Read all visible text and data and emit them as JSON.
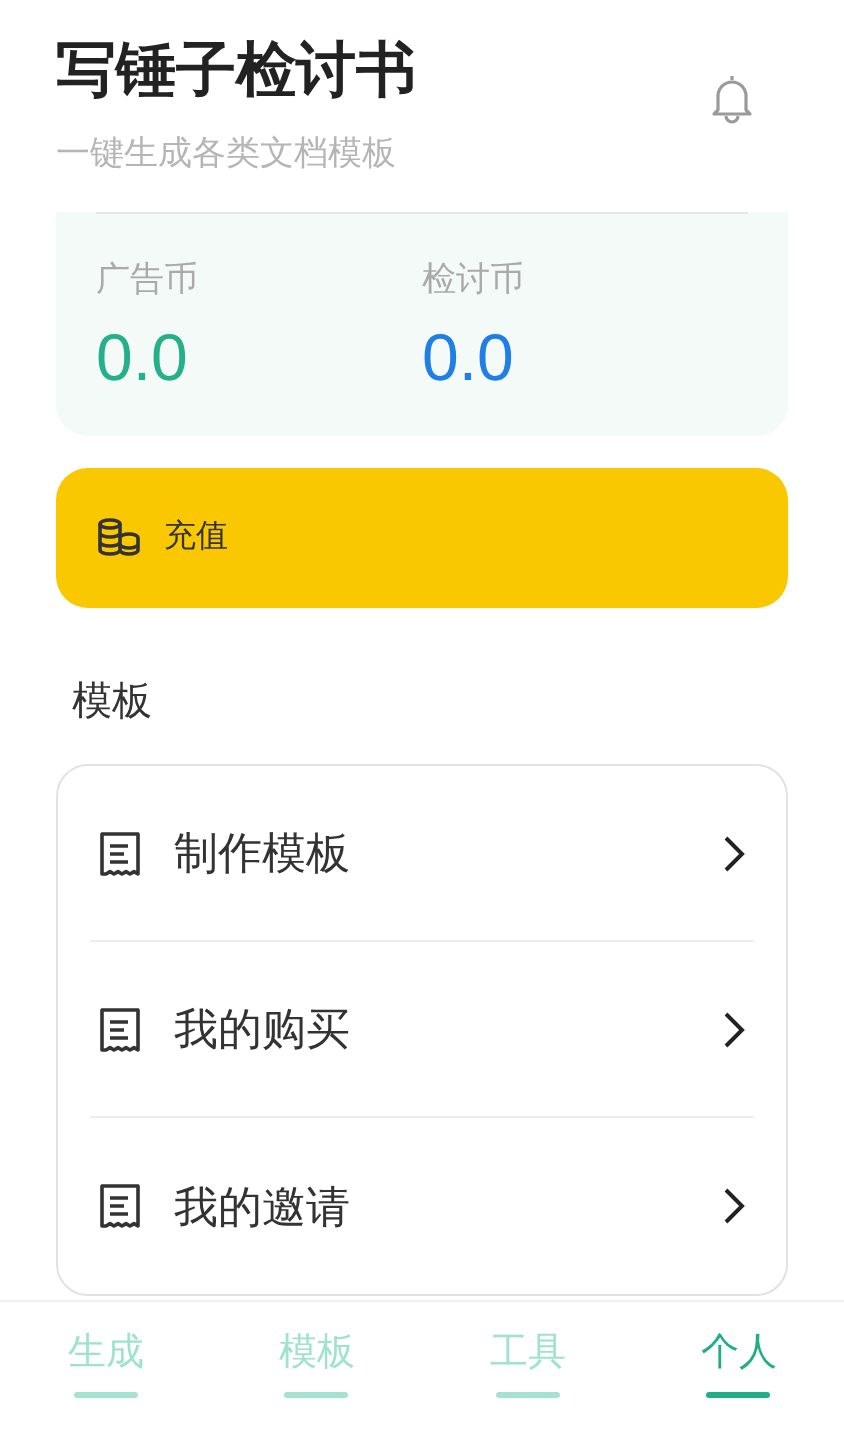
{
  "header": {
    "title": "写锤子检讨书",
    "subtitle": "一键生成各类文档模板"
  },
  "balances": [
    {
      "label": "广告币",
      "value": "0.0",
      "color": "#26b08a"
    },
    {
      "label": "检讨币",
      "value": "0.0",
      "color": "#1f7fe6"
    }
  ],
  "recharge": {
    "label": "充值"
  },
  "section": {
    "title": "模板"
  },
  "menu": [
    {
      "label": "制作模板"
    },
    {
      "label": "我的购买"
    },
    {
      "label": "我的邀请"
    }
  ],
  "tabs": [
    {
      "label": "生成",
      "selected": false
    },
    {
      "label": "模板",
      "selected": false
    },
    {
      "label": "工具",
      "selected": false
    },
    {
      "label": "个人",
      "selected": true
    }
  ]
}
